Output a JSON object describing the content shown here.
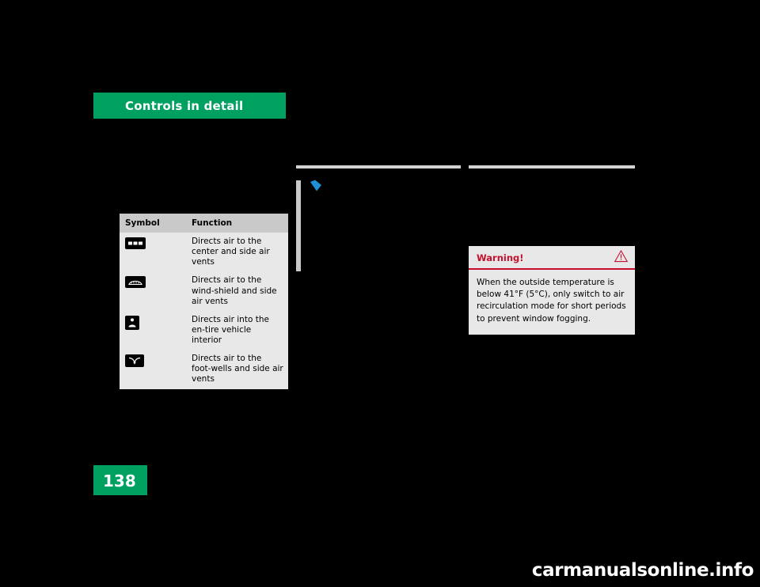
{
  "document": {
    "header": {
      "title": "Controls in detail",
      "banner_color": "#00a160"
    },
    "page_number": "138",
    "watermark": "carmanualsonline.info"
  },
  "symbol_table": {
    "columns": [
      "Symbol",
      "Function"
    ],
    "rows": [
      {
        "icon": "center-and-side-vents-icon",
        "function": "Directs air to the center and side air vents"
      },
      {
        "icon": "windshield-defrost-icon",
        "function": "Directs air to the wind-shield and side air vents"
      },
      {
        "icon": "whole-interior-airflow-icon",
        "function": "Directs air into the en-tire vehicle interior"
      },
      {
        "icon": "footwell-vents-icon",
        "function": "Directs air to the foot-wells and side air vents"
      }
    ]
  },
  "warning": {
    "title": "Warning!",
    "icon": "warning-triangle-icon",
    "text": "When the outside temperature is below 41°F (5°C), only switch to air recirculation mode for short periods to prevent window fogging.",
    "accent_color": "#c8102e"
  },
  "bullet": {
    "icon": "blue-bullet-icon",
    "color": "#1e8fd5"
  }
}
